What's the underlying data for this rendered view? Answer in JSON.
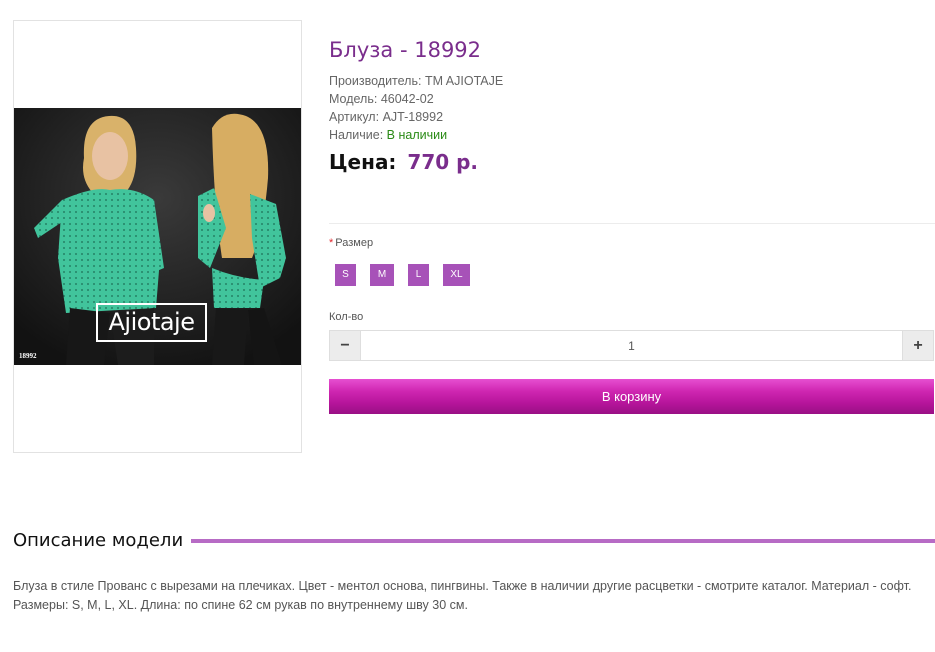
{
  "product": {
    "title": "Блуза - 18992",
    "manufacturer_label": "Производитель:",
    "manufacturer": "TM AJIOTAJE",
    "model_label": "Модель:",
    "model": "46042-02",
    "sku_label": "Артикул:",
    "sku": "AJT-18992",
    "availability_label": "Наличие:",
    "availability": "В наличии",
    "price_label": "Цена:",
    "price": "770 р."
  },
  "image": {
    "brand_text": "Ajiotaje",
    "code_text": "18992"
  },
  "options": {
    "size_required_mark": "*",
    "size_label": "Размер",
    "sizes": [
      "S",
      "M",
      "L",
      "XL"
    ],
    "qty_label": "Кол-во",
    "qty_value": "1",
    "qty_minus": "−",
    "qty_plus": "+"
  },
  "cart": {
    "button_label": "В корзину"
  },
  "description": {
    "heading": "Описание модели",
    "text": "Блуза в стиле Прованс с вырезами на плечиках. Цвет - ментол основа, пингвины. Также в наличии другие расцветки - смотрите каталог. Материал - софт. Размеры: S, M, L, XL. Длина: по спине 62 см рукав по внутреннему шву 30 см."
  },
  "colors": {
    "accent": "#7a2d8c",
    "size_button": "#a752b8",
    "cart_button": "#c41fa8",
    "in_stock": "#2a8a16",
    "blouse": "#3fc29a"
  }
}
